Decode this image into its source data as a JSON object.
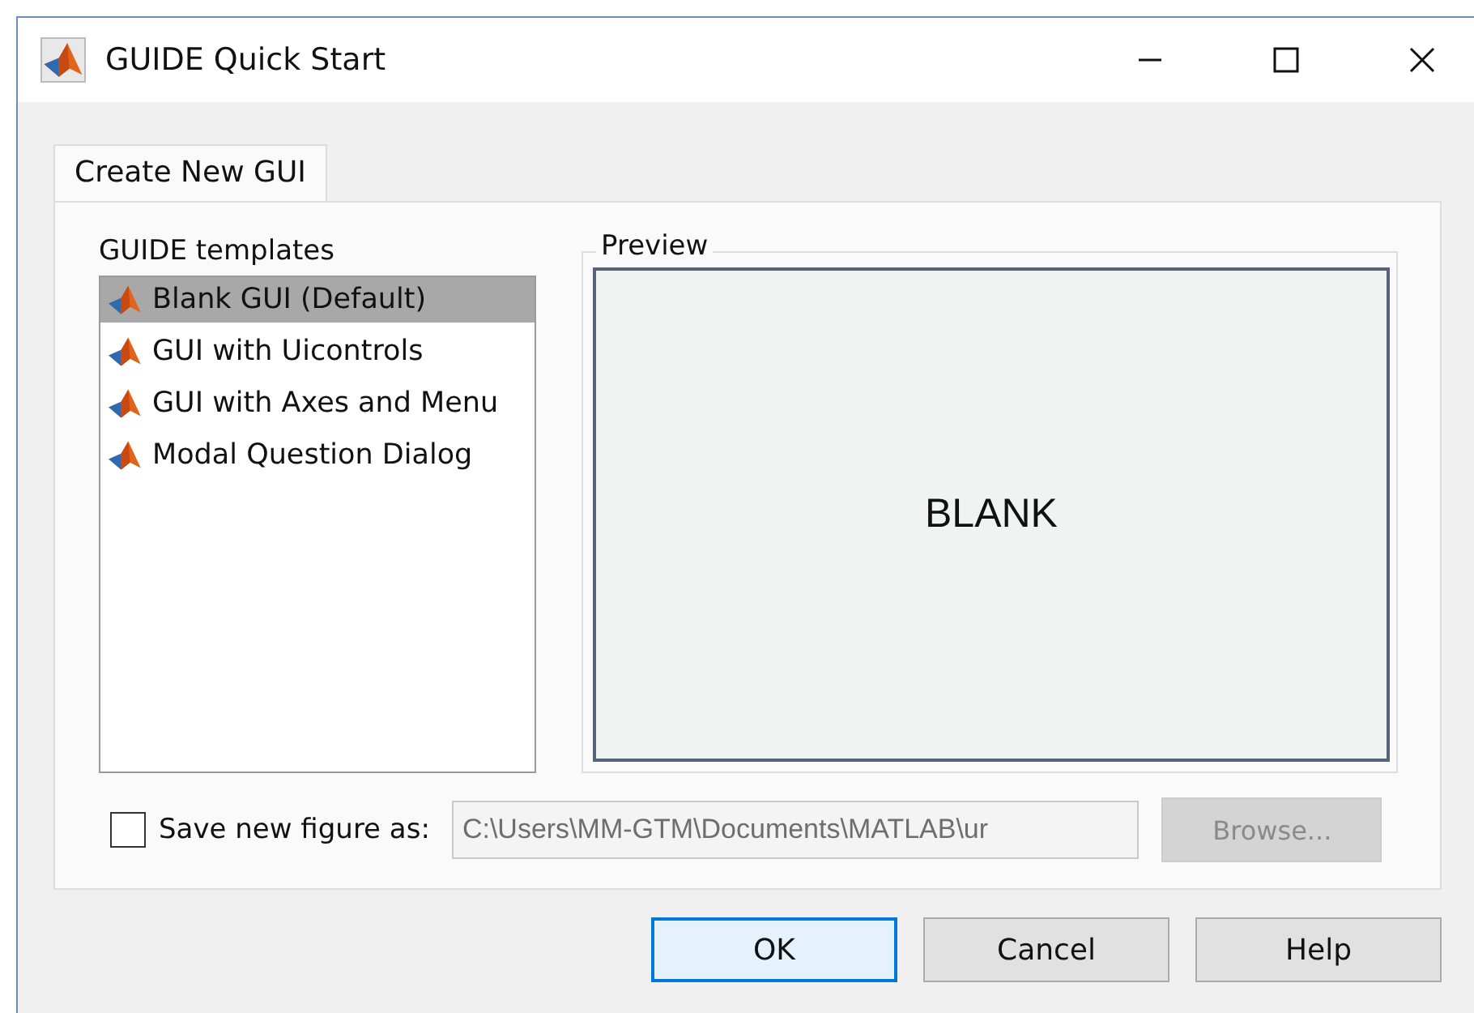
{
  "window": {
    "title": "GUIDE Quick Start"
  },
  "tabs": [
    {
      "label": "Create New GUI",
      "selected": true
    }
  ],
  "templates": {
    "label": "GUIDE templates",
    "items": [
      {
        "label": "Blank GUI (Default)",
        "selected": true
      },
      {
        "label": "GUI with Uicontrols",
        "selected": false
      },
      {
        "label": "GUI with Axes and Menu",
        "selected": false
      },
      {
        "label": "Modal Question Dialog",
        "selected": false
      }
    ]
  },
  "preview": {
    "label": "Preview",
    "text": "BLANK"
  },
  "save": {
    "label": "Save new figure as:",
    "checked": false,
    "path": "C:\\Users\\MM-GTM\\Documents\\MATLAB\\ur",
    "browse": "Browse...",
    "disabled": true
  },
  "buttons": [
    {
      "label": "OK",
      "default": true
    },
    {
      "label": "Cancel",
      "default": false
    },
    {
      "label": "Help",
      "default": false
    }
  ]
}
